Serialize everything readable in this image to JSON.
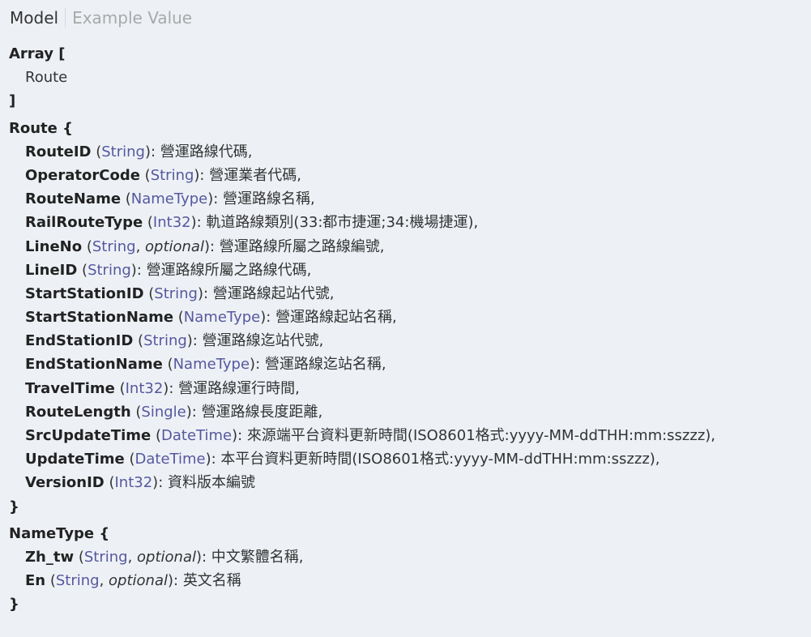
{
  "tabs": {
    "model": "Model",
    "example": "Example Value"
  },
  "colors": {
    "background": "#edf1f6",
    "type": "#55589d",
    "inactive_tab": "#a8a8a8"
  },
  "array_block": {
    "open": "Array [",
    "item": "Route",
    "close": "]"
  },
  "route_model": {
    "open": "Route {",
    "close": "}",
    "fields": [
      {
        "name": "RouteID",
        "type": "String",
        "desc": "營運路線代碼,"
      },
      {
        "name": "OperatorCode",
        "type": "String",
        "desc": "營運業者代碼,"
      },
      {
        "name": "RouteName",
        "type": "NameType",
        "desc": "營運路線名稱,"
      },
      {
        "name": "RailRouteType",
        "type": "Int32",
        "desc": "軌道路線類別(33:都市捷運;34:機場捷運),"
      },
      {
        "name": "LineNo",
        "type": "String",
        "optional": "optional",
        "desc": "營運路線所屬之路線編號,"
      },
      {
        "name": "LineID",
        "type": "String",
        "desc": "營運路線所屬之路線代碼,"
      },
      {
        "name": "StartStationID",
        "type": "String",
        "desc": "營運路線起站代號,"
      },
      {
        "name": "StartStationName",
        "type": "NameType",
        "desc": "營運路線起站名稱,"
      },
      {
        "name": "EndStationID",
        "type": "String",
        "desc": "營運路線迄站代號,"
      },
      {
        "name": "EndStationName",
        "type": "NameType",
        "desc": "營運路線迄站名稱,"
      },
      {
        "name": "TravelTime",
        "type": "Int32",
        "desc": "營運路線運行時間,"
      },
      {
        "name": "RouteLength",
        "type": "Single",
        "desc": "營運路線長度距離,"
      },
      {
        "name": "SrcUpdateTime",
        "type": "DateTime",
        "desc": "來源端平台資料更新時間(ISO8601格式:yyyy-MM-ddTHH:mm:sszzz),"
      },
      {
        "name": "UpdateTime",
        "type": "DateTime",
        "desc": "本平台資料更新時間(ISO8601格式:yyyy-MM-ddTHH:mm:sszzz),"
      },
      {
        "name": "VersionID",
        "type": "Int32",
        "desc": "資料版本編號"
      }
    ]
  },
  "nametype_model": {
    "open": "NameType {",
    "close": "}",
    "fields": [
      {
        "name": "Zh_tw",
        "type": "String",
        "optional": "optional",
        "desc": "中文繁體名稱,"
      },
      {
        "name": "En",
        "type": "String",
        "optional": "optional",
        "desc": "英文名稱"
      }
    ]
  }
}
